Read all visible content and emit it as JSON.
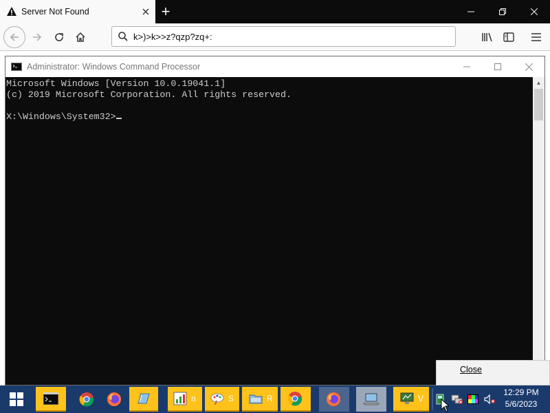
{
  "browser": {
    "tab_title": "Server Not Found",
    "url_text": "k>)>k>>z?qzp?zq+:",
    "new_tab_label": "+"
  },
  "cmd": {
    "window_title": "Administrator: Windows Command Processor",
    "lines": [
      "Microsoft Windows [Version 10.0.19041.1]",
      "(c) 2019 Microsoft Corporation. All rights reserved.",
      "",
      "X:\\Windows\\System32>"
    ]
  },
  "context_menu": {
    "close_label": "Close"
  },
  "taskbar": {
    "apps": [
      {
        "name": "cmd",
        "label": ""
      },
      {
        "name": "chrome",
        "label": ""
      },
      {
        "name": "firefox",
        "label": ""
      },
      {
        "name": "notebook",
        "label": ""
      },
      {
        "name": "chart-tool",
        "label": "n"
      },
      {
        "name": "paint-tool",
        "label": "S"
      },
      {
        "name": "folder-tool",
        "label": "R"
      },
      {
        "name": "chrome-2",
        "label": ""
      },
      {
        "name": "firefox-2",
        "label": ""
      },
      {
        "name": "laptop",
        "label": ""
      },
      {
        "name": "monitor-tool",
        "label": "V"
      }
    ],
    "clock": {
      "time": "12:29 PM",
      "date": "5/6/2023"
    }
  },
  "colors": {
    "taskbar": "#1a3a6c",
    "console_bg": "#0c0c0c",
    "console_text": "#cccccc",
    "warning": "#0c0c0d",
    "app_button_yellow": "#ffc21a"
  }
}
